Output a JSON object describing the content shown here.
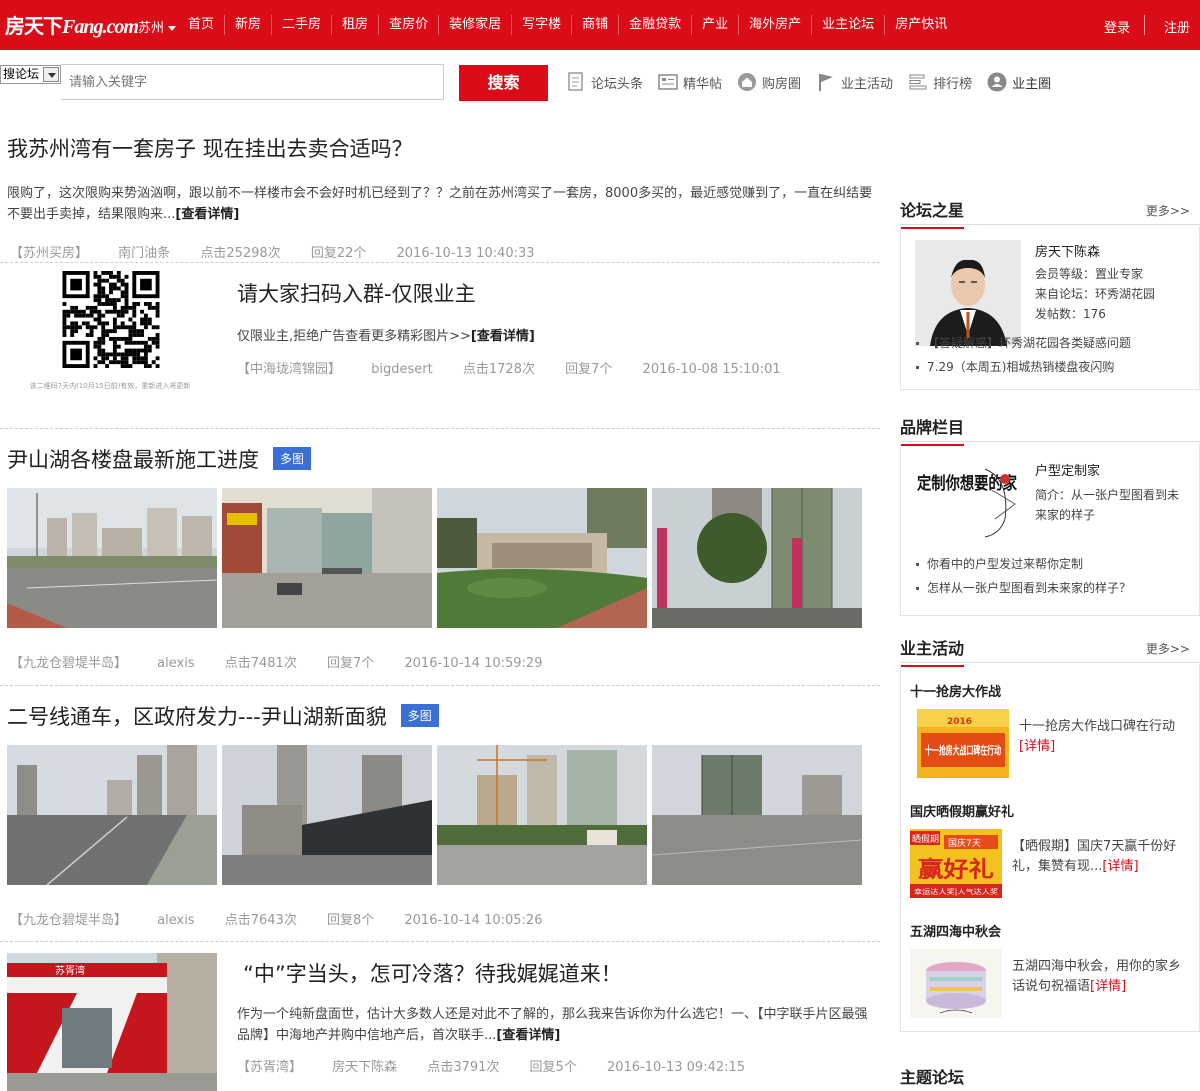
{
  "nav": {
    "logo_main": "房天下",
    "logo_sub": "Fang.com",
    "city": "苏州",
    "items": [
      "首页",
      "新房",
      "二手房",
      "租房",
      "查房价",
      "装修家居",
      "写字楼",
      "商铺",
      "金融贷款",
      "产业",
      "海外房产",
      "业主论坛",
      "房产快讯"
    ],
    "login": "登录",
    "register": "注册"
  },
  "search": {
    "scope": "搜论坛",
    "placeholder": "请输入关键字",
    "button": "搜索",
    "quicklinks": [
      "论坛头条",
      "精华帖",
      "购房圈",
      "业主活动",
      "排行榜",
      "业主圈"
    ]
  },
  "posts": [
    {
      "title": "我苏州湾有一套房子 现在挂出去卖合适吗？",
      "desc": "限购了，这次限购来势汹汹啊，跟以前不一样楼市会不会好时机已经到了？？之前在苏州湾买了一套房，8000多买的，最近感觉赚到了，一直在纠结要不要出手卖掉，结果限购来...",
      "more": "[查看详情]",
      "forum": "【苏州买房】",
      "author": "南门油条",
      "clicks": "点击25298次",
      "replies": "回复22个",
      "date": "2016-10-13  10:40:33"
    },
    {
      "title": "请大家扫码入群-仅限业主",
      "desc": "仅限业主,拒绝广告查看更多精彩图片>>",
      "more": "[查看详情]",
      "forum": "【中海珑湾锦园】",
      "author": "bigdesert",
      "clicks": "点击1728次",
      "replies": "回复7个",
      "date": "2016-10-08  15:10:01",
      "qr_caption": "该二维码7天内(10月15日前)有效，重新进入将更新"
    },
    {
      "title": "尹山湖各楼盘最新施工进度",
      "badge": "多图",
      "forum": "【九龙仓碧堤半岛】",
      "author": "alexis",
      "clicks": "点击7481次",
      "replies": "回复7个",
      "date": "2016-10-14  10:59:29"
    },
    {
      "title": "二号线通车，区政府发力---尹山湖新面貌",
      "badge": "多图",
      "forum": "【九龙仓碧堤半岛】",
      "author": "alexis",
      "clicks": "点击7643次",
      "replies": "回复8个",
      "date": "2016-10-14  10:05:26"
    },
    {
      "title": "“中”字当头，怎可冷落？待我娓娓道来！",
      "desc": "作为一个纯新盘面世，估计大多数人还是对此不了解的，那么我来告诉你为什么选它！一、【中字联手片区最强品牌】中海地产并购中信地产后，首次联手...",
      "more": "[查看详情]",
      "forum": "【苏胥湾】",
      "author": "房天下陈森",
      "clicks": "点击3791次",
      "replies": "回复5个",
      "date": "2016-10-13  09:42:15",
      "image_text": "苏胥湾"
    }
  ],
  "sidebar": {
    "star": {
      "title": "论坛之星",
      "more": "更多>>",
      "name": "房天下陈森",
      "level": "会员等级：置业专家",
      "from": "来自论坛：环秀湖花园",
      "posts": "发帖数：176",
      "list": [
        "【答疑解惑】环秀湖花园各类疑惑问题",
        "7.29（本周五)相城热销楼盘夜闪购"
      ]
    },
    "brand": {
      "title": "品牌栏目",
      "name": "户型定制家",
      "desc": "简介：从一张户型图看到未来家的样子",
      "logo_text": "定制你想要的家",
      "list": [
        "你看中的户型发过来帮你定制",
        "怎样从一张户型图看到未来家的样子？"
      ]
    },
    "activity": {
      "title": "业主活动",
      "more": "更多>>",
      "items": [
        {
          "title": "十一抢房大作战",
          "desc": "十一抢房大作战口碑在行动",
          "link": "[详情]",
          "img_text": "十一抢房大战口碑在行动",
          "img_badge": "2016"
        },
        {
          "title": "国庆晒假期赢好礼",
          "desc": "【晒假期】国庆7天赢千份好礼，集赞有现...",
          "link": "[详情]",
          "img_text": "赢好礼",
          "img_badge": "晒假期",
          "img_sub": "国庆7天",
          "img_foot": "幸运达人奖|人气达人奖"
        },
        {
          "title": "五湖四海中秋会",
          "desc": "五湖四海中秋会，用你的家乡话说句祝福语",
          "link": "[详情]"
        }
      ]
    },
    "topic": {
      "title": "主题论坛"
    }
  }
}
